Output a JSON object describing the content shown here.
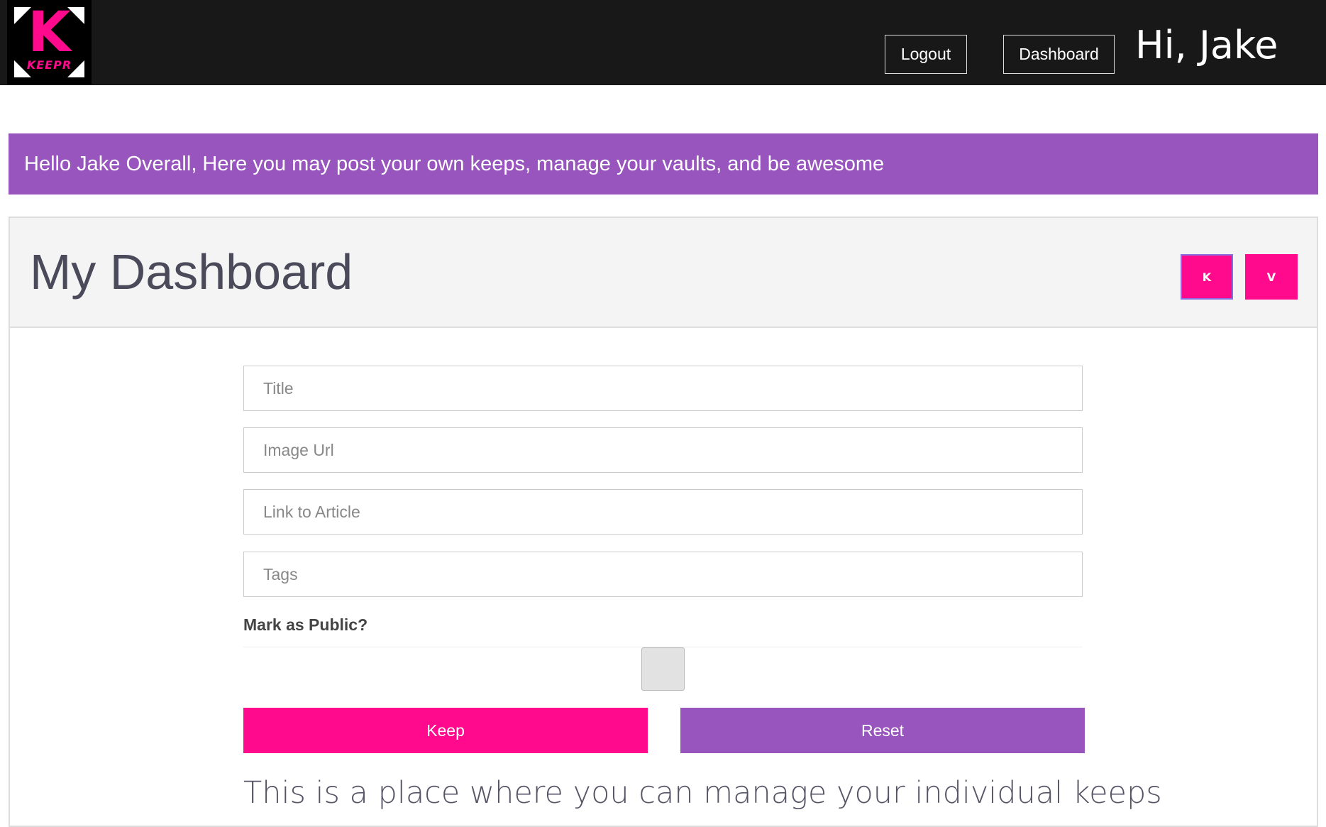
{
  "navbar": {
    "logo": {
      "letter": "K",
      "word": "KEEPR"
    },
    "logout_label": "Logout",
    "dashboard_label": "Dashboard",
    "greeting": "Hi, Jake"
  },
  "banner": {
    "text": "Hello Jake Overall, Here you may post your own keeps, manage your vaults, and be awesome"
  },
  "panel": {
    "title": "My Dashboard",
    "keep_toggle_label": "K",
    "vault_toggle_label": "V"
  },
  "form": {
    "title": {
      "value": "",
      "placeholder": "Title"
    },
    "image_url": {
      "value": "",
      "placeholder": "Image Url"
    },
    "article_link": {
      "value": "",
      "placeholder": "Link to Article"
    },
    "tags": {
      "value": "",
      "placeholder": "Tags"
    },
    "public_label": "Mark as Public?",
    "public_checked": false,
    "keep_label": "Keep",
    "reset_label": "Reset"
  },
  "tagline": "This is a place where you can manage your individual keeps",
  "colors": {
    "navbar_bg": "#181818",
    "accent_pink": "#ff0a8c",
    "accent_purple": "#9855bd",
    "panel_header_bg": "#f4f4f4"
  }
}
